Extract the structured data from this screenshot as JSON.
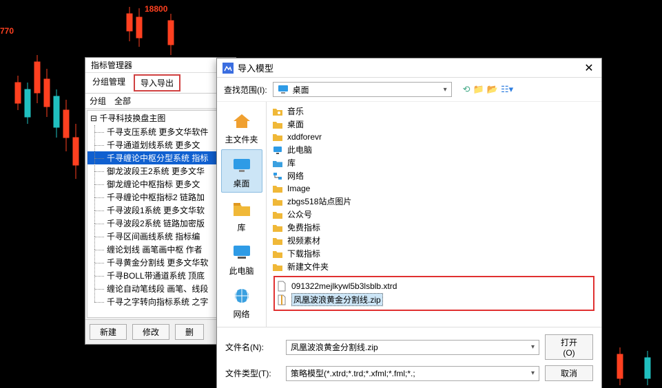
{
  "domain": "Computer-Use",
  "chart": {
    "price_top": "18800",
    "price_side": "770"
  },
  "indicator_manager": {
    "title": "指标管理器",
    "tabs": {
      "group_mgmt": "分组管理",
      "import_export": "导入导出"
    },
    "subtabs": {
      "group": "分组",
      "all": "全部"
    },
    "tree_root": "千寻科技换盘主图",
    "tree_items": [
      "千寻支压系统 更多文华软件",
      "千寻通道划线系统 更多文",
      "千寻缠论中枢分型系统 指标",
      "御龙波段王2系统 更多文华",
      "御龙缠论中枢指标 更多文",
      "千寻缠论中枢指标2 链路加",
      "千寻波段1系统 更多文华软",
      "千寻波段2系统 链路加密版",
      "千寻区间画线系统 指标编",
      "缠论划线 画笔画中枢 作者",
      "千寻黄金分割线 更多文华软",
      "千寻BOLL带通道系统 顶底",
      "缠论自动笔线段 画笔、线段",
      "千寻之字转向指标系统 之字"
    ],
    "selected_index": 2,
    "footer": {
      "new": "新建",
      "modify": "修改",
      "delete": "删"
    }
  },
  "import_dialog": {
    "title": "导入模型",
    "look_in_label": "查找范围(I):",
    "look_in_value": "桌面",
    "places": [
      {
        "key": "home",
        "label": "主文件夹"
      },
      {
        "key": "desktop",
        "label": "桌面"
      },
      {
        "key": "library",
        "label": "库"
      },
      {
        "key": "thispc",
        "label": "此电脑"
      },
      {
        "key": "network",
        "label": "网络"
      }
    ],
    "places_selected": 1,
    "files": [
      {
        "icon": "folder-music",
        "name": "音乐"
      },
      {
        "icon": "folder",
        "name": "桌面"
      },
      {
        "icon": "folder",
        "name": "xddforevr"
      },
      {
        "icon": "thispc",
        "name": "此电脑"
      },
      {
        "icon": "library",
        "name": "库"
      },
      {
        "icon": "network",
        "name": "网络"
      },
      {
        "icon": "folder",
        "name": "Image"
      },
      {
        "icon": "folder",
        "name": "zbgs518站点图片"
      },
      {
        "icon": "folder",
        "name": "公众号"
      },
      {
        "icon": "folder",
        "name": "免费指标"
      },
      {
        "icon": "folder",
        "name": "视频素材"
      },
      {
        "icon": "folder",
        "name": "下载指标"
      },
      {
        "icon": "folder",
        "name": "新建文件夹"
      }
    ],
    "highlighted_files": [
      {
        "icon": "file",
        "name": "091322mejlkywl5b3lsblb.xtrd",
        "selected": false
      },
      {
        "icon": "zip",
        "name": "凤凰波浪黄金分割线.zip",
        "selected": true
      }
    ],
    "filename_label": "文件名(N):",
    "filename_value": "凤凰波浪黄金分割线.zip",
    "filetype_label": "文件类型(T):",
    "filetype_value": "策略模型(*.xtrd;*.trd;*.xfml;*.fml;*.;",
    "open_btn": "打开(O)",
    "cancel_btn": "取消"
  }
}
